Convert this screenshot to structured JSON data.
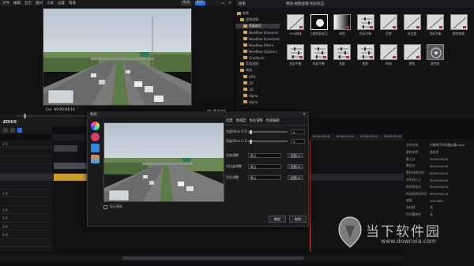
{
  "menubar": {
    "items": [
      "文件",
      "编辑",
      "显示",
      "素材",
      "工具",
      "设置",
      "帮助"
    ],
    "pl_label": "PLR",
    "rec_label": "REC"
  },
  "player": {
    "timecode_label": "Cur",
    "timecode": "00:00:04;14"
  },
  "effects_panel": {
    "title": "效果",
    "tree_items": [
      {
        "label": "效果",
        "selected": false
      },
      {
        "label": "视频滤镜",
        "selected": false
      },
      {
        "label": "色彩校正",
        "selected": true
      },
      {
        "label": "NewBlue Elements",
        "selected": false
      },
      {
        "label": "NewBlue Essentials",
        "selected": false
      },
      {
        "label": "NewBlue Filters",
        "selected": false
      },
      {
        "label": "NewBlue Stylizers",
        "selected": false
      },
      {
        "label": "Gradients",
        "selected": false
      },
      {
        "label": "音频滤镜",
        "selected": false
      },
      {
        "label": "转场",
        "selected": false
      },
      {
        "label": "GPU",
        "selected": false
      },
      {
        "label": "2D",
        "selected": false
      },
      {
        "label": "3D",
        "selected": false
      },
      {
        "label": "Alpha",
        "selected": false
      },
      {
        "label": "Alpha",
        "selected": false
      }
    ],
    "breadcrumb": "特效-视频滤镜-色彩校正",
    "items": [
      {
        "label": "YUV曲线",
        "kind": "curve"
      },
      {
        "label": "三路色彩校正",
        "kind": "circle"
      },
      {
        "label": "单色",
        "kind": "gradient"
      },
      {
        "label": "色彩平衡",
        "kind": "sliders"
      },
      {
        "label": "反转",
        "kind": "diagonal"
      },
      {
        "label": "对比度",
        "kind": "diagonal"
      },
      {
        "label": "色彩平衡",
        "kind": "diagonal"
      },
      {
        "label": "颜色转换",
        "kind": "diagonal"
      },
      {
        "label": "色彩平衡",
        "kind": "sliders"
      },
      {
        "label": "色彩平衡",
        "kind": "sliders"
      },
      {
        "label": "亮度",
        "kind": "sliders"
      },
      {
        "label": "颜色",
        "kind": "sliders"
      },
      {
        "label": "转场",
        "kind": "diagonal"
      },
      {
        "label": "颜色",
        "kind": "diagonal"
      },
      {
        "label": "颜色轮",
        "kind": "wheel"
      }
    ]
  },
  "timeline": {
    "logo": "EDIUS",
    "track_labels": [
      "1 V",
      "",
      "",
      "",
      "",
      "",
      "1 V",
      "",
      "1 A",
      "2 A",
      "3 A",
      "4 A",
      ""
    ],
    "ruler_labels": [
      "00:00:00;00",
      "00:00:10;00",
      "00:00:15;00",
      "00:00:20;00"
    ]
  },
  "dialog": {
    "title": "色彩",
    "tabs": [
      "亮度",
      "饱和度",
      "色彩调整",
      "色调偏移"
    ],
    "rows": [
      {
        "label": "亮度(Bias 0.5)",
        "type": "slider",
        "value": "0"
      },
      {
        "label": "亮度(Bias 0.1)",
        "type": "slider",
        "value": "0"
      },
      {
        "label": "亮度调整",
        "type": "combo",
        "value": "默认",
        "btn": "设置(1)"
      },
      {
        "label": "对比度调整",
        "type": "combo",
        "value": "默认",
        "btn": "设置(2)"
      },
      {
        "label": "色彩调整",
        "type": "combo",
        "value": "默认",
        "btn": "设置(3)"
      }
    ],
    "checkbox_label": "显示预览",
    "ok_label": "确定",
    "cancel_label": "取消"
  },
  "info_panel": {
    "rows": [
      {
        "k": "文件名称",
        "v": "行驶的汽车高速公路.mp4"
      },
      {
        "k": "素材名称",
        "v": "会议文"
      },
      {
        "k": "素入点",
        "v": "00:00:00;00"
      },
      {
        "k": "素出点",
        "v": "00:00:04;00"
      },
      {
        "k": "素材持续时间",
        "v": "00:00:04;14"
      },
      {
        "k": "时间线入点",
        "v": "00:00:00;00"
      },
      {
        "k": "时间线出点",
        "v": "00:00:04;14"
      },
      {
        "k": "时间线持续时间",
        "v": "00:00:04;14"
      },
      {
        "k": "速度",
        "v": "100.00%"
      },
      {
        "k": "冻结帧",
        "v": "无"
      },
      {
        "k": "时间重映射",
        "v": "无"
      },
      {
        "k": "",
        "v": ""
      },
      {
        "k": "",
        "v": ""
      },
      {
        "k": "",
        "v": ""
      }
    ]
  },
  "watermark": {
    "brand": "当下软件园",
    "url": "www.downxia.com"
  }
}
